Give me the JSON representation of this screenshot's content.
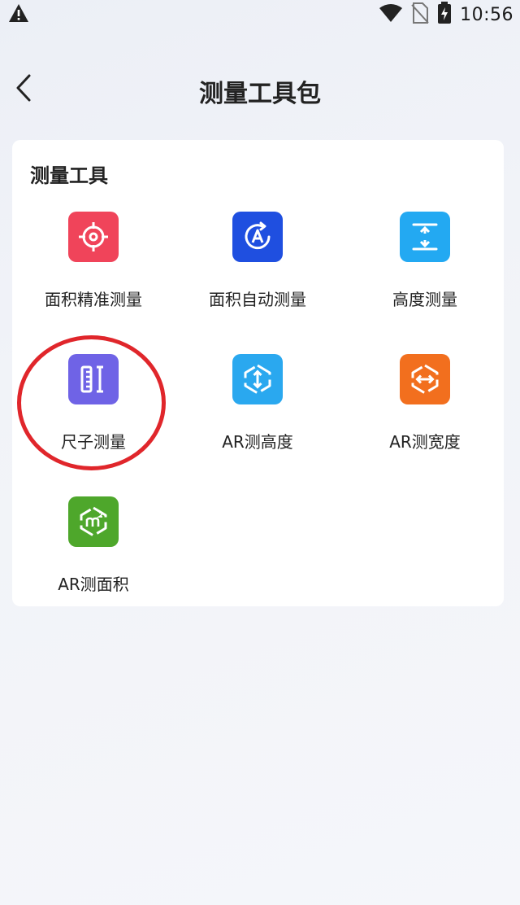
{
  "status_bar": {
    "time": "10:56",
    "icons": [
      "warning-icon",
      "wifi-icon",
      "no-sim-icon",
      "battery-charging-icon"
    ]
  },
  "header": {
    "title": "测量工具包",
    "back_icon": "chevron-left-icon"
  },
  "section": {
    "title": "测量工具",
    "tools": [
      {
        "label": "面积精准测量",
        "icon": "crosshair-target-icon",
        "color": "#f0445a"
      },
      {
        "label": "面积自动测量",
        "icon": "auto-a-icon",
        "color": "#1f4fe0"
      },
      {
        "label": "高度测量",
        "icon": "vertical-arrows-icon",
        "color": "#23a9f2"
      },
      {
        "label": "尺子测量",
        "icon": "ruler-icon",
        "color": "#6f63e6"
      },
      {
        "label": "AR测高度",
        "icon": "ar-height-icon",
        "color": "#2aa8ef"
      },
      {
        "label": "AR测宽度",
        "icon": "ar-width-icon",
        "color": "#f26f1e"
      },
      {
        "label": "AR测面积",
        "icon": "ar-area-icon",
        "color": "#4ea72b"
      }
    ]
  },
  "annotation": {
    "highlight_color": "#e0262b"
  }
}
